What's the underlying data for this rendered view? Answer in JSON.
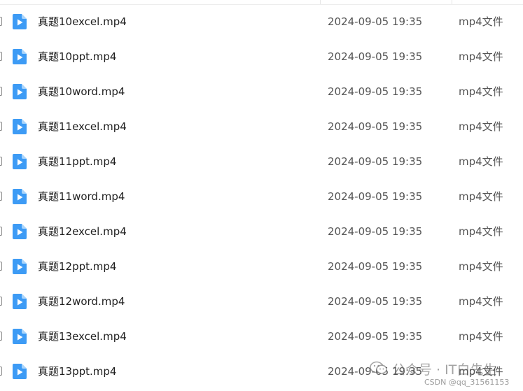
{
  "files": [
    {
      "name": "真题10excel.mp4",
      "date": "2024-09-05 19:35",
      "type": "mp4文件"
    },
    {
      "name": "真题10ppt.mp4",
      "date": "2024-09-05 19:35",
      "type": "mp4文件"
    },
    {
      "name": "真题10word.mp4",
      "date": "2024-09-05 19:35",
      "type": "mp4文件"
    },
    {
      "name": "真题11excel.mp4",
      "date": "2024-09-05 19:35",
      "type": "mp4文件"
    },
    {
      "name": "真题11ppt.mp4",
      "date": "2024-09-05 19:35",
      "type": "mp4文件"
    },
    {
      "name": "真题11word.mp4",
      "date": "2024-09-05 19:35",
      "type": "mp4文件"
    },
    {
      "name": "真题12excel.mp4",
      "date": "2024-09-05 19:35",
      "type": "mp4文件"
    },
    {
      "name": "真题12ppt.mp4",
      "date": "2024-09-05 19:35",
      "type": "mp4文件"
    },
    {
      "name": "真题12word.mp4",
      "date": "2024-09-05 19:35",
      "type": "mp4文件"
    },
    {
      "name": "真题13excel.mp4",
      "date": "2024-09-05 19:35",
      "type": "mp4文件"
    },
    {
      "name": "真题13ppt.mp4",
      "date": "2024-09-05 19:35",
      "type": "mp4文件"
    }
  ],
  "icons": {
    "file": "video-file-icon",
    "watermark": "wechat-icon"
  },
  "colors": {
    "icon_blue": "#3d9bf5",
    "icon_fold": "#a8d4fb"
  },
  "watermark": {
    "line1": "公众号 · IT白先生",
    "line2": "CSDN @qq_31561153"
  }
}
